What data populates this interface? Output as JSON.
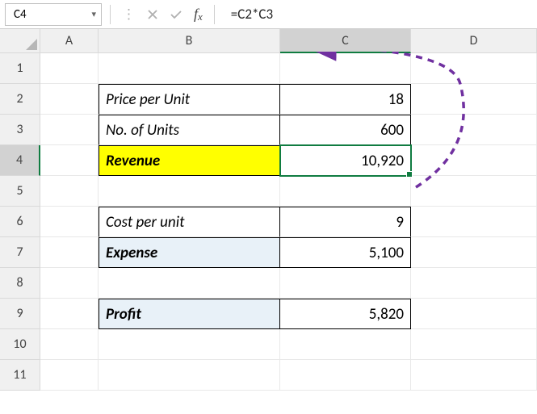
{
  "formula_bar": {
    "name_box": "C4",
    "formula": "=C2*C3"
  },
  "columns": [
    "A",
    "B",
    "C",
    "D"
  ],
  "row_numbers": [
    "1",
    "2",
    "3",
    "4",
    "5",
    "6",
    "7",
    "8",
    "9",
    "10",
    "11"
  ],
  "cells": {
    "B2": "Price per Unit",
    "C2": "18",
    "B3": "No. of Units",
    "C3": "600",
    "B4": "Revenue",
    "C4": "10,920",
    "B6": "Cost per unit",
    "C6": "9",
    "B7": "Expense",
    "C7": "5,100",
    "B9": "Profit",
    "C9": "5,820"
  },
  "active_cell": "C4",
  "colors": {
    "selection": "#107c41",
    "highlight": "#ffff00",
    "shade": "#e8f1f8",
    "arrow": "#7030a0"
  }
}
